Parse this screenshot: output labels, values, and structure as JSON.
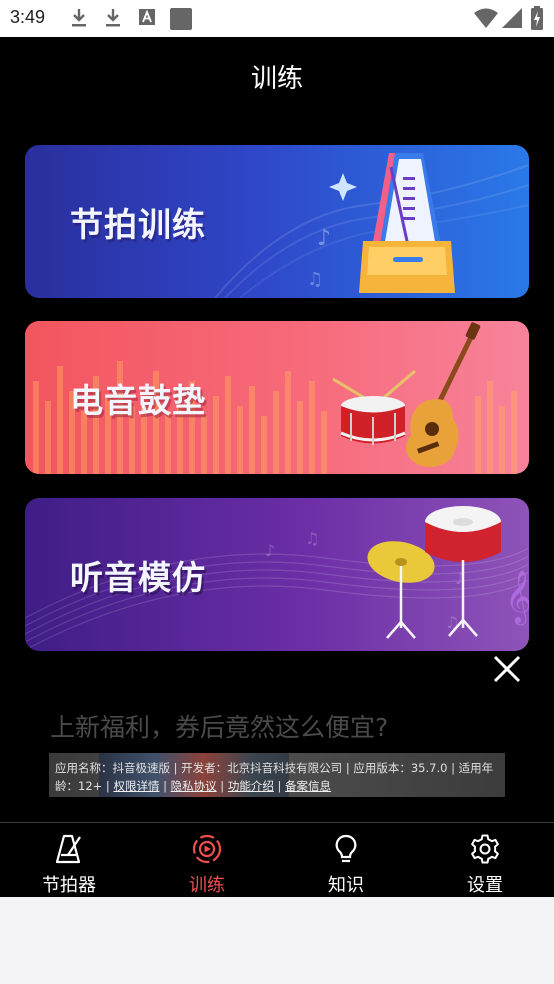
{
  "status_bar": {
    "time": "3:49",
    "icons": [
      "download-icon",
      "download-icon",
      "font-icon",
      "square-icon"
    ],
    "right_icons": [
      "wifi-icon",
      "signal-icon",
      "battery-icon"
    ]
  },
  "header": {
    "title": "训练"
  },
  "cards": [
    {
      "label": "节拍训练",
      "icon": "metronome-icon"
    },
    {
      "label": "电音鼓垫",
      "icon": "drum-guitar-icon"
    },
    {
      "label": "听音模仿",
      "icon": "cymbal-drum-icon"
    }
  ],
  "ad": {
    "title": "上新福利，券后竟然这么便宜?",
    "info_prefix": "应用名称：抖音极速版 | 开发者：北京抖音科技有限公司 | 应用版本：35.7.0 | 适用年龄：12+ | ",
    "link_permissions": "权限详情",
    "sep1": " | ",
    "link_privacy": "隐私协议",
    "sep2": " | ",
    "link_features": "功能介绍",
    "sep3": " | ",
    "link_filing": "备案信息"
  },
  "tabs": [
    {
      "label": "节拍器",
      "icon": "metronome-icon",
      "active": false
    },
    {
      "label": "训练",
      "icon": "training-target-icon",
      "active": true
    },
    {
      "label": "知识",
      "icon": "lightbulb-icon",
      "active": false
    },
    {
      "label": "设置",
      "icon": "gear-icon",
      "active": false
    }
  ],
  "colors": {
    "active_tab": "#f04f4f",
    "background": "#000000"
  }
}
